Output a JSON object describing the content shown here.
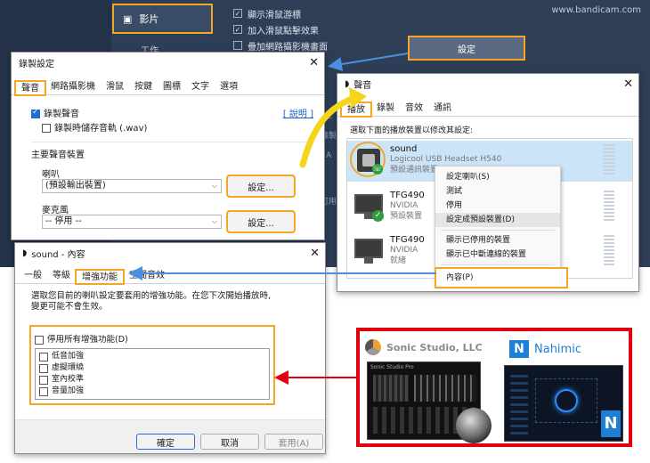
{
  "background": {
    "sidebar_video_label": "影片",
    "sidebar_second_label": "工作",
    "checkboxes": [
      "顯示滑鼠游標",
      "加入滑鼠點擊效果",
      "疊加網路攝影機畫面"
    ],
    "settings_button": "設定",
    "watermark": "www.bandicam.com",
    "side_fragments": [
      "Siz",
      "錄製",
      "- A",
      "可用"
    ]
  },
  "recording_settings": {
    "title": "錄製設定",
    "tabs": [
      "聲音",
      "網路攝影機",
      "滑鼠",
      "按鍵",
      "圖標",
      "文字",
      "選項"
    ],
    "record_audio_label": "錄製聲音",
    "help_link": "[ 說明 ]",
    "save_wav_label": "錄製時儲存音軌 (.wav)",
    "primary_device_heading": "主要聲音裝置",
    "speaker_label": "喇叭",
    "speaker_value": "(預設輸出裝置)",
    "speaker_settings_button": "設定...",
    "mic_label": "麥克風",
    "mic_value": "-- 停用 --",
    "mic_settings_button": "設定..."
  },
  "sound_dialog": {
    "title": "聲音",
    "tabs": [
      "播放",
      "錄製",
      "音效",
      "通訊"
    ],
    "instruction": "選取下面的播放裝置以修改其設定:",
    "devices": [
      {
        "name": "sound",
        "sub1": "Logicool USB Headset H540",
        "sub2": "預設通訊裝置"
      },
      {
        "name": "TFG490",
        "sub1": "NVIDIA",
        "sub2": "預設裝置"
      },
      {
        "name": "TFG490",
        "sub1": "NVIDIA",
        "sub2": "就緒"
      }
    ]
  },
  "context_menu": {
    "items": [
      "設定喇叭(S)",
      "測試",
      "停用",
      "設定成預設裝置(D)",
      "顯示已停用的裝置",
      "顯示已中斷連線的裝置",
      "內容(P)"
    ]
  },
  "properties_dialog": {
    "title": "sound - 內容",
    "tabs": [
      "一般",
      "等級",
      "增強功能",
      "空間音效"
    ],
    "description_line1": "選取您目前的喇叭設定要套用的增強功能。在您下次開始播放時,",
    "description_line2": "變更可能不會生效。",
    "disable_all_label": "停用所有增強功能(D)",
    "enhancements": [
      "低音加強",
      "虛擬環繞",
      "室內校準",
      "音量加強"
    ],
    "ok_button": "確定",
    "cancel_button": "取消",
    "apply_button": "套用(A)"
  },
  "promo": {
    "sonic_studio_label": "Sonic Studio, LLC",
    "sonic_studio_screen_title": "Sonic Studio Pro",
    "nahimic_label": "Nahimic"
  },
  "colors": {
    "highlight": "#f5a623",
    "promo_border": "#e0000f",
    "bg_app": "#2d3e56"
  }
}
